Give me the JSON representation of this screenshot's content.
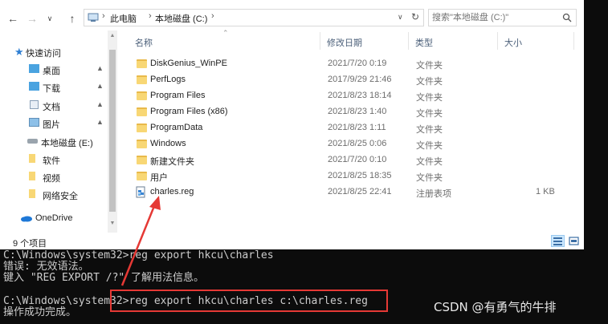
{
  "console": {
    "lines": [
      "C:\\Windows\\system32>reg export hkcu\\charles",
      "错误: 无效语法。",
      "键入 \"REG EXPORT /?\" 了解用法信息。",
      "",
      "C:\\Windows\\system32>reg export hkcu\\charles c:\\charles.reg",
      "操作成功完成。"
    ]
  },
  "explorer": {
    "address": {
      "crumbs": [
        "此电脑",
        "本地磁盘 (C:)"
      ],
      "search_placeholder": "搜索\"本地磁盘 (C:)\""
    },
    "nav": [
      {
        "label": "快速访问",
        "icon": "star-icon",
        "pinned": false
      },
      {
        "label": "桌面",
        "icon": "desktop-folder-icon",
        "pinned": true
      },
      {
        "label": "下载",
        "icon": "download-folder-icon",
        "pinned": true
      },
      {
        "label": "文档",
        "icon": "document-folder-icon",
        "pinned": true
      },
      {
        "label": "图片",
        "icon": "picture-folder-icon",
        "pinned": true
      },
      {
        "label": "本地磁盘 (E:)",
        "icon": "drive-icon",
        "pinned": false
      },
      {
        "label": "软件",
        "icon": "folder-icon",
        "pinned": false
      },
      {
        "label": "视频",
        "icon": "folder-icon",
        "pinned": false
      },
      {
        "label": "网络安全",
        "icon": "folder-icon",
        "pinned": false
      },
      {
        "label": "OneDrive",
        "icon": "onedrive-icon",
        "pinned": false
      }
    ],
    "columns": {
      "name": "名称",
      "modified": "修改日期",
      "type": "类型",
      "size": "大小"
    },
    "files": [
      {
        "name": "DiskGenius_WinPE",
        "modified": "2021/7/20 0:19",
        "type": "文件夹",
        "size": "",
        "kind": "folder"
      },
      {
        "name": "PerfLogs",
        "modified": "2017/9/29 21:46",
        "type": "文件夹",
        "size": "",
        "kind": "folder"
      },
      {
        "name": "Program Files",
        "modified": "2021/8/23 18:14",
        "type": "文件夹",
        "size": "",
        "kind": "folder"
      },
      {
        "name": "Program Files (x86)",
        "modified": "2021/8/23 1:40",
        "type": "文件夹",
        "size": "",
        "kind": "folder"
      },
      {
        "name": "ProgramData",
        "modified": "2021/8/23 1:11",
        "type": "文件夹",
        "size": "",
        "kind": "folder"
      },
      {
        "name": "Windows",
        "modified": "2021/8/25 0:06",
        "type": "文件夹",
        "size": "",
        "kind": "folder"
      },
      {
        "name": "新建文件夹",
        "modified": "2021/7/20 0:10",
        "type": "文件夹",
        "size": "",
        "kind": "folder"
      },
      {
        "name": "用户",
        "modified": "2021/8/25 18:35",
        "type": "文件夹",
        "size": "",
        "kind": "folder"
      },
      {
        "name": "charles.reg",
        "modified": "2021/8/25 22:41",
        "type": "注册表项",
        "size": "1 KB",
        "kind": "reg"
      }
    ],
    "status": "9 个项目"
  },
  "watermark": "CSDN @有勇气的牛排",
  "colors": {
    "annotation": "#e53935",
    "folder": "#f8d775"
  }
}
